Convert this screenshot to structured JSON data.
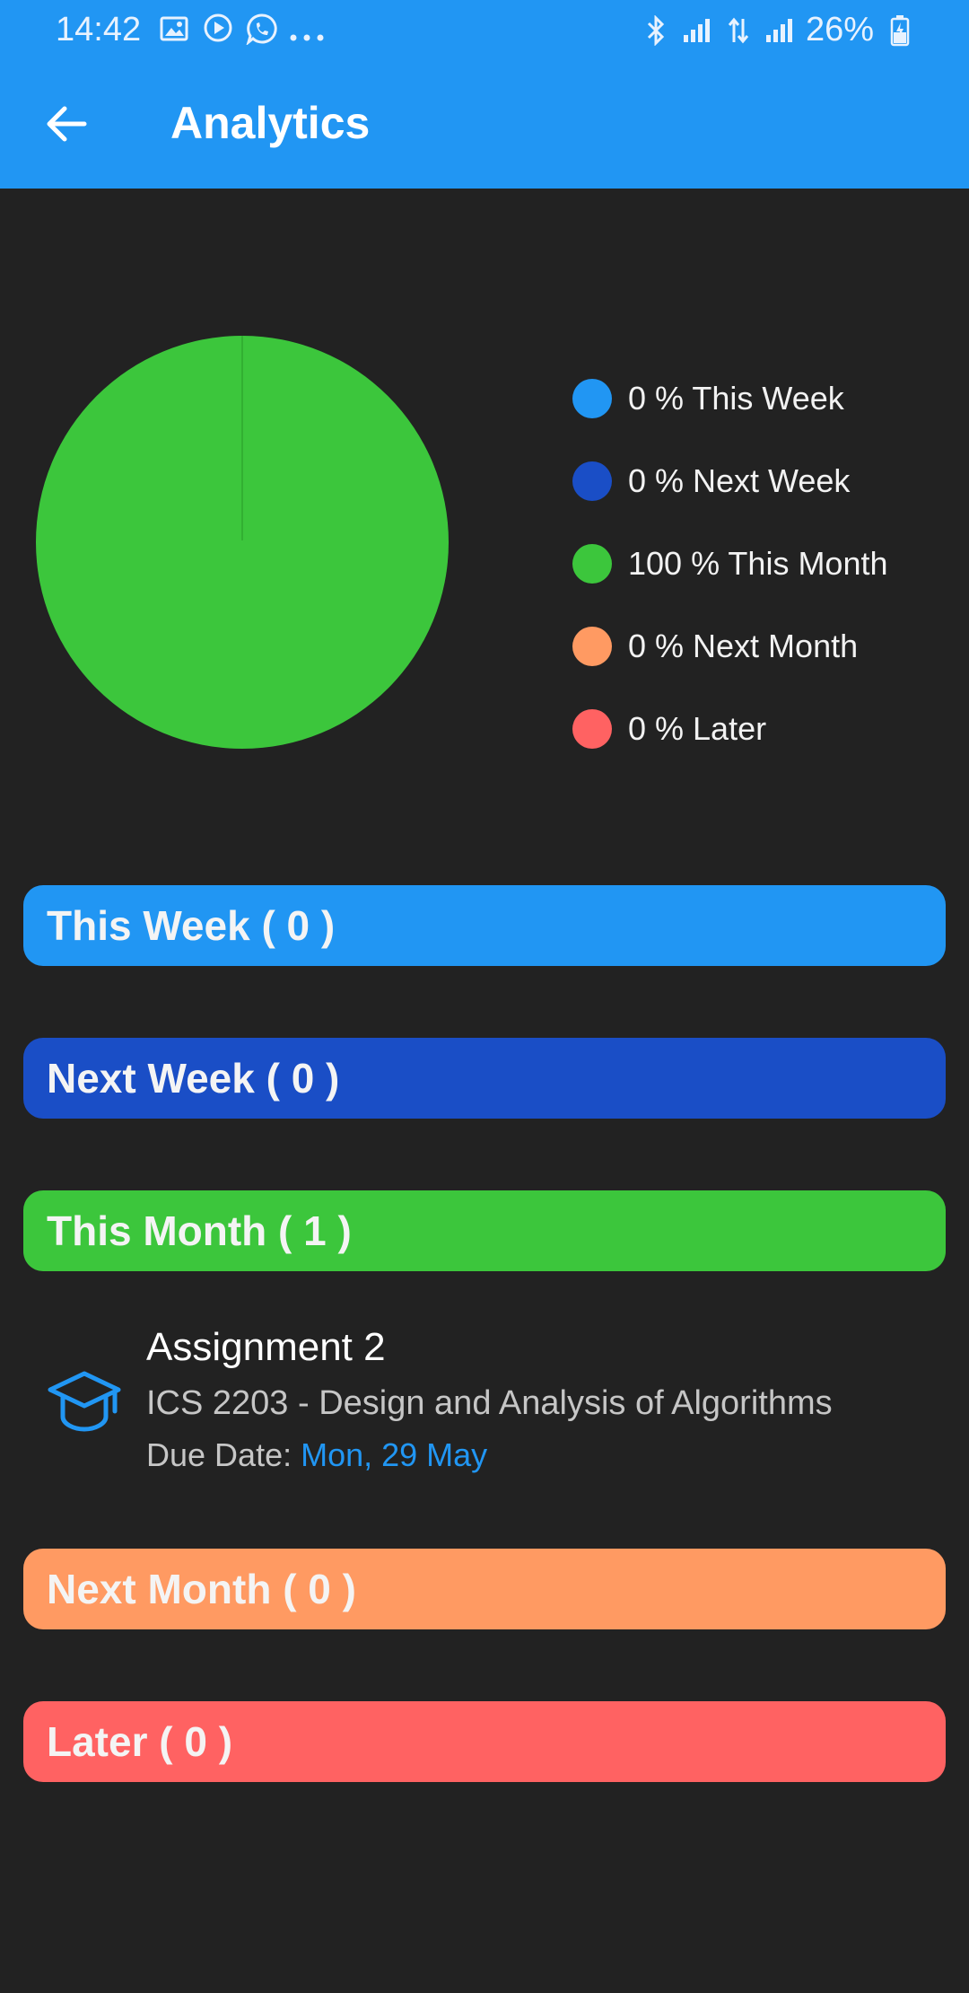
{
  "status_bar": {
    "time": "14:42",
    "left_icons": [
      "image-icon",
      "play-icon",
      "whatsapp-icon",
      "more-dots-icon"
    ],
    "right_icons": [
      "bluetooth-icon",
      "signal-icon",
      "data-transfer-icon",
      "signal-icon"
    ],
    "battery": "26%"
  },
  "toolbar": {
    "back_icon": "arrow-left-icon",
    "title": "Analytics"
  },
  "colors": {
    "app_bar": "#2196f3",
    "background": "#222222",
    "this_week": "#2196f3",
    "next_week": "#1a4ec6",
    "this_month": "#3cc63c",
    "next_month": "#ff9a62",
    "later": "#ff6262"
  },
  "chart_data": {
    "type": "pie",
    "labels": [
      "This Week",
      "Next Week",
      "This Month",
      "Next Month",
      "Later"
    ],
    "values": [
      0,
      0,
      100,
      0,
      0
    ],
    "legend_position": "right",
    "legend": [
      {
        "text": "0 % This Week",
        "color": "#2196f3"
      },
      {
        "text": "0 % Next Week",
        "color": "#1a4ec6"
      },
      {
        "text": "100 % This Month",
        "color": "#3cc63c"
      },
      {
        "text": "0 % Next Month",
        "color": "#ff9a62"
      },
      {
        "text": "0 % Later",
        "color": "#ff6262"
      }
    ]
  },
  "sections": [
    {
      "label": "This Week ( 0 )",
      "color": "#2196f3"
    },
    {
      "label": "Next Week ( 0 )",
      "color": "#1a4ec6"
    },
    {
      "label": "This Month ( 1 )",
      "color": "#3cc63c"
    },
    {
      "label": "Next Month ( 0 )",
      "color": "#ff9a62"
    },
    {
      "label": "Later ( 0 )",
      "color": "#ff6262"
    }
  ],
  "assignment": {
    "icon": "graduation-cap-icon",
    "title": "Assignment 2",
    "course": "ICS 2203 - Design and Analysis of Algorithms",
    "due_label": "Due Date: ",
    "due_value": "Mon, 29 May"
  }
}
